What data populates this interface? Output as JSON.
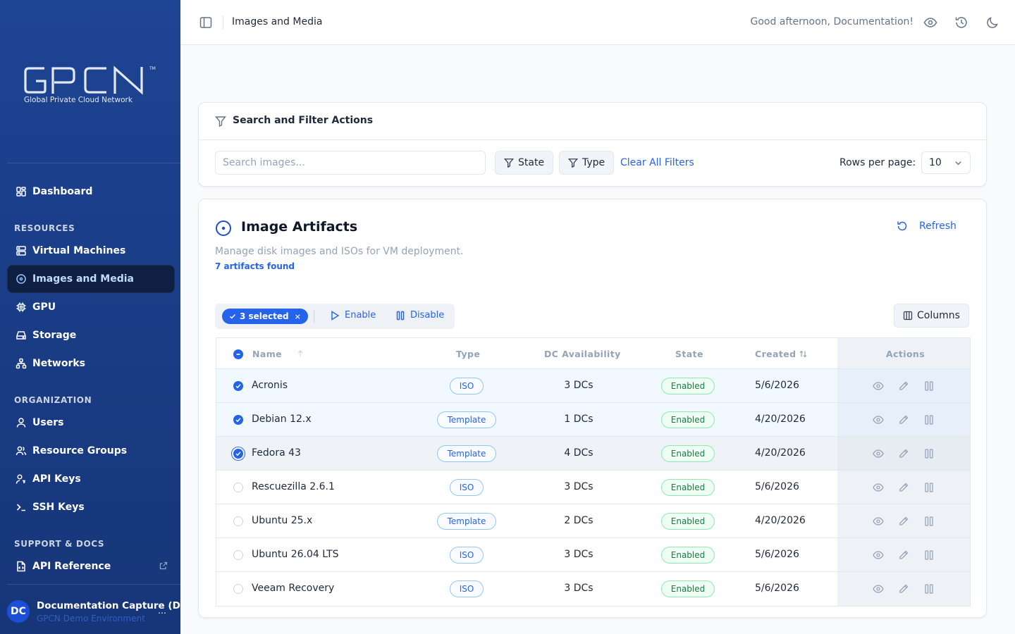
{
  "brand": {
    "logo": "GPCN",
    "tagline": "Global Private Cloud Network",
    "tm": "TM"
  },
  "sidebar": {
    "dashboard": "Dashboard",
    "sections": {
      "resources": "RESOURCES",
      "organization": "ORGANIZATION",
      "support": "SUPPORT & DOCS"
    },
    "resources": [
      "Virtual Machines",
      "Images and Media",
      "GPU",
      "Storage",
      "Networks"
    ],
    "organization": [
      "Users",
      "Resource Groups",
      "API Keys",
      "SSH Keys"
    ],
    "support": [
      "API Reference"
    ],
    "active": "Images and Media"
  },
  "user": {
    "initials": "DC",
    "name": "Documentation Capture (Do",
    "env": "GPCN Demo Environment",
    "more": "…"
  },
  "topbar": {
    "title": "Images and Media",
    "greeting": "Good afternoon, Documentation!"
  },
  "filters": {
    "title": "Search and Filter Actions",
    "search_placeholder": "Search images...",
    "state_label": "State",
    "type_label": "Type",
    "clear_label": "Clear All Filters",
    "rows_per_page_label": "Rows per page:",
    "rows_per_page_value": "10"
  },
  "artifacts": {
    "title": "Image Artifacts",
    "refresh_label": "Refresh",
    "description": "Manage disk images and ISOs for VM deployment.",
    "count_text": "7 artifacts found",
    "bulk": {
      "selected_label": "3 selected",
      "clear": "×",
      "enable_label": "Enable",
      "disable_label": "Disable"
    },
    "columns_label": "Columns",
    "headers": {
      "name": "Name",
      "type": "Type",
      "dc": "DC Availability",
      "state": "State",
      "created": "Created",
      "actions": "Actions"
    },
    "rows": [
      {
        "name": "Acronis",
        "type": "ISO",
        "dc": "3 DCs",
        "state": "Enabled",
        "created": "5/6/2026",
        "selected": true
      },
      {
        "name": "Debian 12.x",
        "type": "Template",
        "dc": "1 DCs",
        "state": "Enabled",
        "created": "4/20/2026",
        "selected": true
      },
      {
        "name": "Fedora 43",
        "type": "Template",
        "dc": "4 DCs",
        "state": "Enabled",
        "created": "4/20/2026",
        "selected": true
      },
      {
        "name": "Rescuezilla 2.6.1",
        "type": "ISO",
        "dc": "3 DCs",
        "state": "Enabled",
        "created": "5/6/2026",
        "selected": false
      },
      {
        "name": "Ubuntu 25.x",
        "type": "Template",
        "dc": "2 DCs",
        "state": "Enabled",
        "created": "4/20/2026",
        "selected": false
      },
      {
        "name": "Ubuntu 26.04 LTS",
        "type": "ISO",
        "dc": "3 DCs",
        "state": "Enabled",
        "created": "5/6/2026",
        "selected": false
      },
      {
        "name": "Veeam Recovery",
        "type": "ISO",
        "dc": "3 DCs",
        "state": "Enabled",
        "created": "5/6/2026",
        "selected": false
      }
    ]
  },
  "colors": {
    "sidebar": "#1e4494",
    "accent": "#2563eb",
    "active_nav": "#0f1f44",
    "success": "#15803d"
  }
}
